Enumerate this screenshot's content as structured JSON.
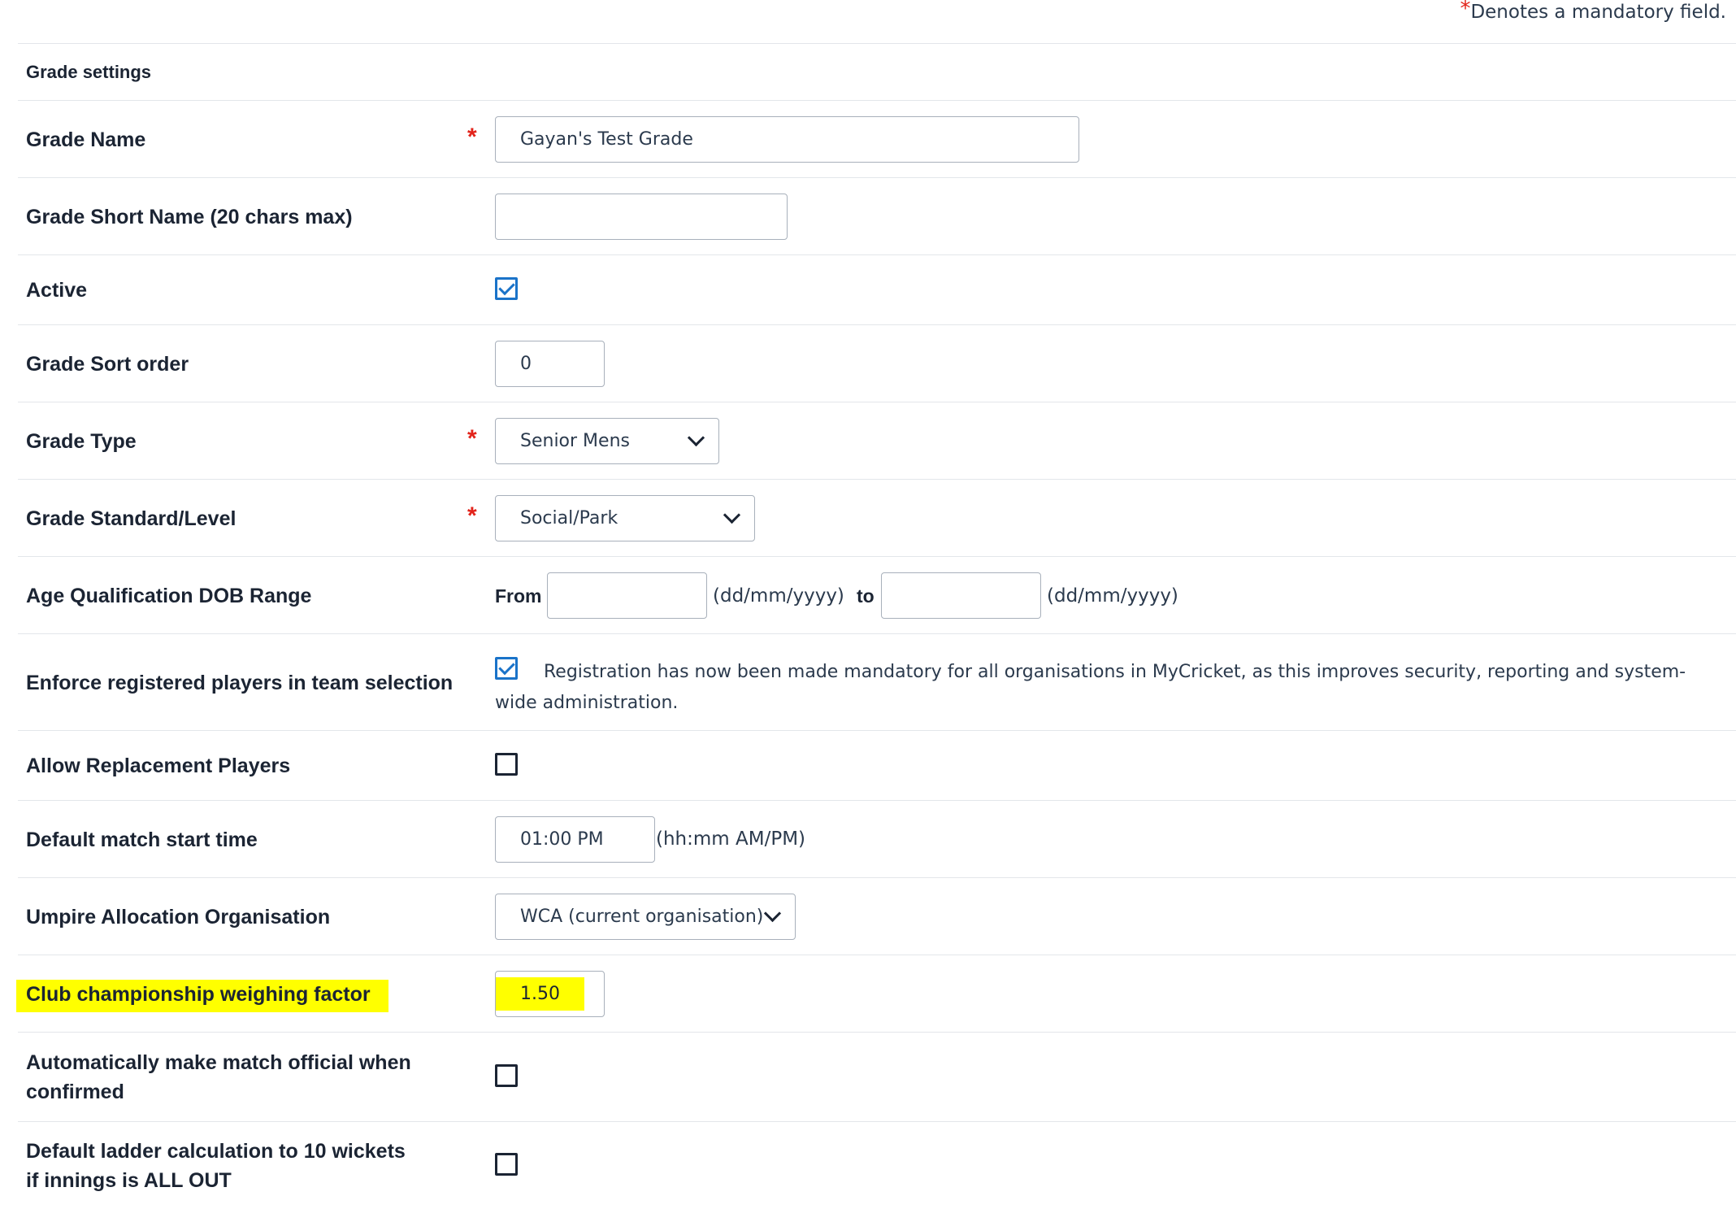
{
  "mandatory_note": {
    "star": "*",
    "text": "Denotes a mandatory field."
  },
  "section": {
    "title": "Grade settings"
  },
  "fields": {
    "grade_name": {
      "label": "Grade Name",
      "required": "*",
      "value": "Gayan's Test Grade"
    },
    "grade_short_name": {
      "label": "Grade Short Name (20 chars max)",
      "value": ""
    },
    "active": {
      "label": "Active",
      "checked": true
    },
    "grade_sort_order": {
      "label": "Grade Sort order",
      "value": "0"
    },
    "grade_type": {
      "label": "Grade Type",
      "required": "*",
      "value": "Senior Mens"
    },
    "grade_standard": {
      "label": "Grade Standard/Level",
      "required": "*",
      "value": "Social/Park"
    },
    "age_qualification": {
      "label": "Age Qualification DOB Range",
      "from_label": "From",
      "from_value": "",
      "from_format": "(dd/mm/yyyy)",
      "to_label": "to",
      "to_value": "",
      "to_format": "(dd/mm/yyyy)"
    },
    "enforce_registered": {
      "label": "Enforce registered players in team selection",
      "checked": true,
      "note": "Registration has now been made mandatory for all organisations in MyCricket, as this improves security, reporting and system-wide administration."
    },
    "allow_replacement": {
      "label": "Allow Replacement Players",
      "checked": false
    },
    "default_start_time": {
      "label": "Default match start time",
      "value": "01:00 PM",
      "format": "(hh:mm AM/PM)"
    },
    "umpire_allocation": {
      "label": "Umpire Allocation Organisation",
      "value": "WCA (current organisation)"
    },
    "club_championship": {
      "label": "Club championship weighing factor",
      "value": "1.50"
    },
    "auto_match_official": {
      "label_line1": "Automatically make match official when",
      "label_line2": "confirmed",
      "checked": false
    },
    "default_ladder": {
      "label_line1": "Default ladder calculation to 10 wickets",
      "label_line2": "if innings is ALL OUT",
      "checked": false
    }
  },
  "colors": {
    "required": "#e2231a",
    "checkbox_checked": "#1a73c9",
    "highlight": "#ffff00"
  }
}
